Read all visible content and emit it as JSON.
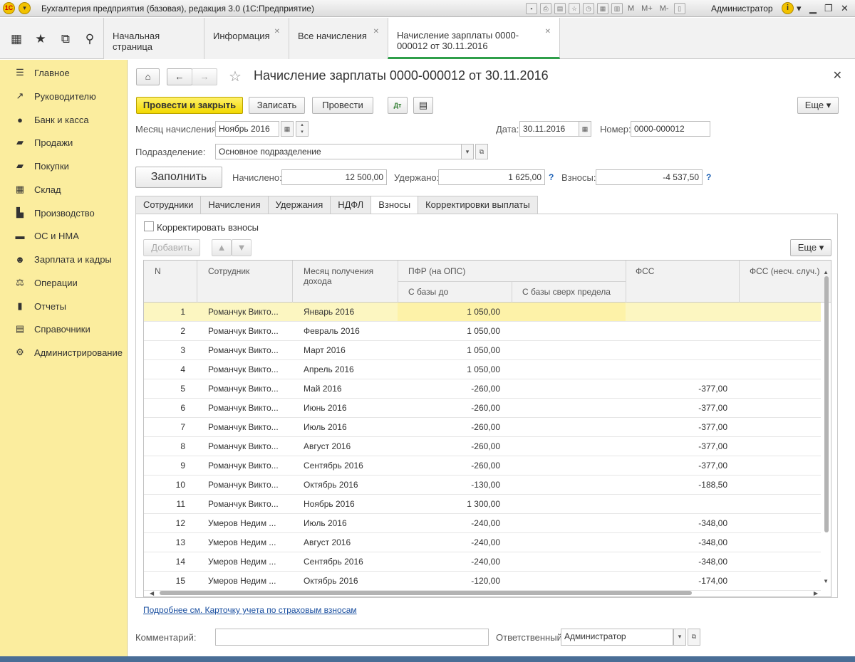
{
  "window": {
    "title": "Бухгалтерия предприятия (базовая), редакция 3.0  (1С:Предприятие)",
    "user": "Администратор",
    "m_buttons": [
      "M",
      "M+",
      "M-"
    ]
  },
  "tabs": [
    {
      "label": "Начальная страница"
    },
    {
      "label": "Информация"
    },
    {
      "label": "Все начисления"
    },
    {
      "label": "Начисление зарплаты 0000-000012 от 30.11.2016"
    }
  ],
  "sidebar": {
    "items": [
      {
        "label": "Главное",
        "icon": "menu-icon"
      },
      {
        "label": "Руководителю",
        "icon": "trend-icon"
      },
      {
        "label": "Банк и касса",
        "icon": "coin-icon"
      },
      {
        "label": "Продажи",
        "icon": "cart-out-icon"
      },
      {
        "label": "Покупки",
        "icon": "cart-icon"
      },
      {
        "label": "Склад",
        "icon": "grid-icon"
      },
      {
        "label": "Производство",
        "icon": "factory-icon"
      },
      {
        "label": "ОС и НМА",
        "icon": "truck-icon"
      },
      {
        "label": "Зарплата и кадры",
        "icon": "people-icon"
      },
      {
        "label": "Операции",
        "icon": "operations-icon"
      },
      {
        "label": "Отчеты",
        "icon": "bars-icon"
      },
      {
        "label": "Справочники",
        "icon": "book-icon"
      },
      {
        "label": "Администрирование",
        "icon": "gear-icon"
      }
    ]
  },
  "form": {
    "title": "Начисление зарплаты 0000-000012 от 30.11.2016",
    "toolbar": {
      "post_close": "Провести и закрыть",
      "save": "Записать",
      "post": "Провести",
      "more": "Еще"
    },
    "month_label": "Месяц начисления:",
    "month_value": "Ноябрь 2016",
    "date_label": "Дата:",
    "date_value": "30.11.2016",
    "number_label": "Номер:",
    "number_value": "0000-000012",
    "division_label": "Подразделение:",
    "division_value": "Основное подразделение",
    "fill_button": "Заполнить",
    "accrued_label": "Начислено:",
    "accrued_value": "12 500,00",
    "withheld_label": "Удержано:",
    "withheld_value": "1 625,00",
    "contributions_label": "Взносы:",
    "contributions_value": "-4 537,50",
    "help": "?",
    "comment_label": "Комментарий:",
    "comment_value": "",
    "responsible_label": "Ответственный:",
    "responsible_value": "Администратор"
  },
  "form_tabs": [
    {
      "label": "Сотрудники"
    },
    {
      "label": "Начисления"
    },
    {
      "label": "Удержания"
    },
    {
      "label": "НДФЛ"
    },
    {
      "label": "Взносы"
    },
    {
      "label": "Корректировки выплаты"
    }
  ],
  "contrib": {
    "correct_label": "Корректировать взносы",
    "add_button": "Добавить",
    "more": "Еще",
    "link": "Подробнее см. Карточку учета по страховым взносам"
  },
  "table": {
    "headers": {
      "n": "N",
      "employee": "Сотрудник",
      "month1": "Месяц получения",
      "month2": "дохода",
      "pfr": "ПФР (на ОПС)",
      "pfr_base": "С базы до",
      "pfr_over": "С базы сверх предела",
      "fss": "ФСС",
      "fss_ns": "ФСС (несч. случ.)"
    },
    "rows": [
      {
        "n": "1",
        "employee": "Романчук Викто...",
        "month": "Январь 2016",
        "pfr": "1 050,00",
        "fss": ""
      },
      {
        "n": "2",
        "employee": "Романчук Викто...",
        "month": "Февраль 2016",
        "pfr": "1 050,00",
        "fss": ""
      },
      {
        "n": "3",
        "employee": "Романчук Викто...",
        "month": "Март 2016",
        "pfr": "1 050,00",
        "fss": ""
      },
      {
        "n": "4",
        "employee": "Романчук Викто...",
        "month": "Апрель 2016",
        "pfr": "1 050,00",
        "fss": ""
      },
      {
        "n": "5",
        "employee": "Романчук Викто...",
        "month": "Май 2016",
        "pfr": "-260,00",
        "fss": "-377,00"
      },
      {
        "n": "6",
        "employee": "Романчук Викто...",
        "month": "Июнь 2016",
        "pfr": "-260,00",
        "fss": "-377,00"
      },
      {
        "n": "7",
        "employee": "Романчук Викто...",
        "month": "Июль 2016",
        "pfr": "-260,00",
        "fss": "-377,00"
      },
      {
        "n": "8",
        "employee": "Романчук Викто...",
        "month": "Август 2016",
        "pfr": "-260,00",
        "fss": "-377,00"
      },
      {
        "n": "9",
        "employee": "Романчук Викто...",
        "month": "Сентябрь 2016",
        "pfr": "-260,00",
        "fss": "-377,00"
      },
      {
        "n": "10",
        "employee": "Романчук Викто...",
        "month": "Октябрь 2016",
        "pfr": "-130,00",
        "fss": "-188,50"
      },
      {
        "n": "11",
        "employee": "Романчук Викто...",
        "month": "Ноябрь 2016",
        "pfr": "1 300,00",
        "fss": ""
      },
      {
        "n": "12",
        "employee": "Умеров Недим ...",
        "month": "Июль 2016",
        "pfr": "-240,00",
        "fss": "-348,00"
      },
      {
        "n": "13",
        "employee": "Умеров Недим ...",
        "month": "Август 2016",
        "pfr": "-240,00",
        "fss": "-348,00"
      },
      {
        "n": "14",
        "employee": "Умеров Недим ...",
        "month": "Сентябрь 2016",
        "pfr": "-240,00",
        "fss": "-348,00"
      },
      {
        "n": "15",
        "employee": "Умеров Недим ...",
        "month": "Октябрь 2016",
        "pfr": "-120,00",
        "fss": "-174,00"
      }
    ]
  },
  "colors": {
    "sidebar_bg": "#fbed9e",
    "primary_button": "#f2d800",
    "active_tab_underline": "#2f9f4a",
    "selected_row": "#fcf6c1"
  }
}
